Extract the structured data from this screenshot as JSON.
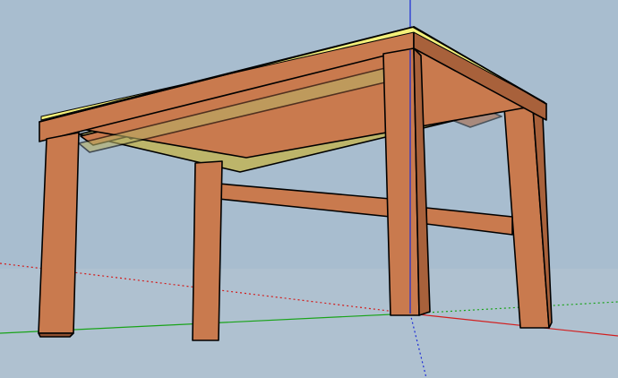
{
  "colors": {
    "sky": "#a7bccf",
    "ground": "#b8c7d2",
    "wood_face": "#c97a4e",
    "wood_shadow": "#a8613b",
    "wood_dark": "#8d4f30",
    "panel_top": "#f4f07a",
    "panel_under": "#bdb56a",
    "axis_red": "#d21e1e",
    "axis_green": "#19a319",
    "axis_blue": "#1a2ad6"
  }
}
